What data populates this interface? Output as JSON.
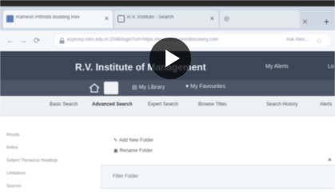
{
  "browser": {
    "tabs": [
      {
        "title": "Ramesh Pithrida Building Rev",
        "active": true
      },
      {
        "title": "R.V. Institute - Search",
        "active": false
      },
      {
        "title": "",
        "active": false
      }
    ],
    "url": "ezproxy.rvim.edu.in:2048/login?url=https://www.dmfusiondiscovery.com",
    "url_right": "Ask Alex..."
  },
  "site": {
    "title": "R.V. Institute of Management",
    "header_nav": [
      "My Alerts",
      "Lo"
    ],
    "sub_nav": [
      "My Library",
      "My Favourites"
    ],
    "menu": [
      "Basic Search",
      "Advanced Search",
      "Expert Search",
      "Browse Titles",
      "Search History",
      "Alerts"
    ]
  },
  "content": {
    "sidebar": [
      "Results",
      "Refine",
      "Subject Thesaurus Headings",
      "Limitations",
      "Sources"
    ],
    "links": [
      "Add New Folder",
      "Rename Folder"
    ],
    "filter_placeholder": "Filter Folder"
  },
  "video": {
    "overlay": "play"
  }
}
